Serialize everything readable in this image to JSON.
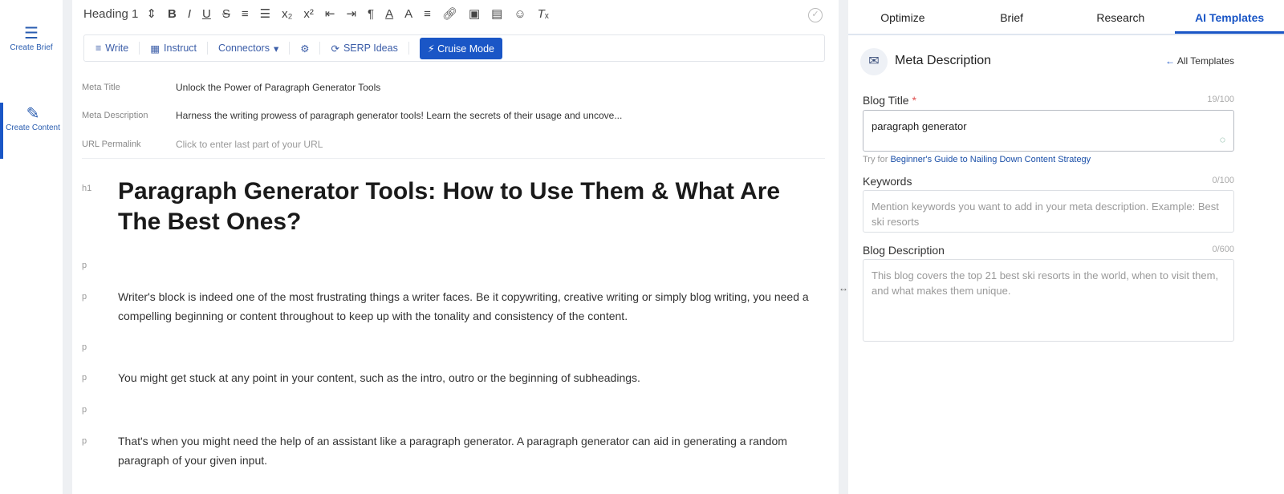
{
  "sidebar": {
    "items": [
      {
        "label": "Create Brief",
        "icon": "list-icon"
      },
      {
        "label": "Create Content",
        "icon": "edit-icon"
      }
    ]
  },
  "toolbar": {
    "heading": "Heading 1",
    "icons": [
      "bold",
      "italic",
      "underline",
      "strikethrough",
      "ordered-list",
      "bullet-list",
      "subscript",
      "superscript",
      "outdent",
      "indent",
      "paragraph-direction",
      "font-color",
      "highlight",
      "align",
      "link",
      "image",
      "video",
      "emoji",
      "clear-format"
    ]
  },
  "ai_bar": {
    "write": "Write",
    "instruct": "Instruct",
    "connectors": "Connectors",
    "serp": "SERP Ideas",
    "cruise": "Cruise Mode"
  },
  "meta": {
    "title_label": "Meta Title",
    "title": "Unlock the Power of Paragraph Generator Tools",
    "desc_label": "Meta Description",
    "desc": "Harness the writing prowess of paragraph generator tools! Learn the secrets of their usage and uncove...",
    "url_label": "URL Permalink",
    "url": "Click to enter last part of your URL"
  },
  "content": {
    "h1_tag": "h1",
    "p_tag": "p",
    "heading": "Paragraph Generator Tools: How to Use Them & What Are The Best Ones?",
    "paragraphs": [
      "Writer's block is indeed one of the most frustrating things a writer faces. Be it copywriting, creative writing or simply blog writing, you need a compelling beginning or content throughout to keep up with the tonality and consistency of the content.",
      "You might get stuck at any point in your content, such as the intro, outro or the beginning of subheadings.",
      "That's when you might need the help of an assistant like a paragraph generator. A paragraph generator can aid in generating a random paragraph of your given input."
    ]
  },
  "right": {
    "tabs": [
      "Optimize",
      "Brief",
      "Research",
      "AI Templates"
    ],
    "template": "Meta Description",
    "all_templates": "All Templates",
    "blog_title_label": "Blog Title",
    "required": "*",
    "blog_title_count": "19/100",
    "blog_title": "paragraph generator",
    "try_for": "Try for",
    "try_link": "Beginner's Guide to Nailing Down Content Strategy",
    "keywords_label": "Keywords",
    "keywords_count": "0/100",
    "keywords_placeholder": "Mention keywords you want to add in your meta description. Example: Best ski resorts",
    "desc_label": "Blog Description",
    "desc_count": "0/600",
    "desc_placeholder": "This blog covers the top 21 best ski resorts in the world, when to visit them, and what makes them unique."
  }
}
